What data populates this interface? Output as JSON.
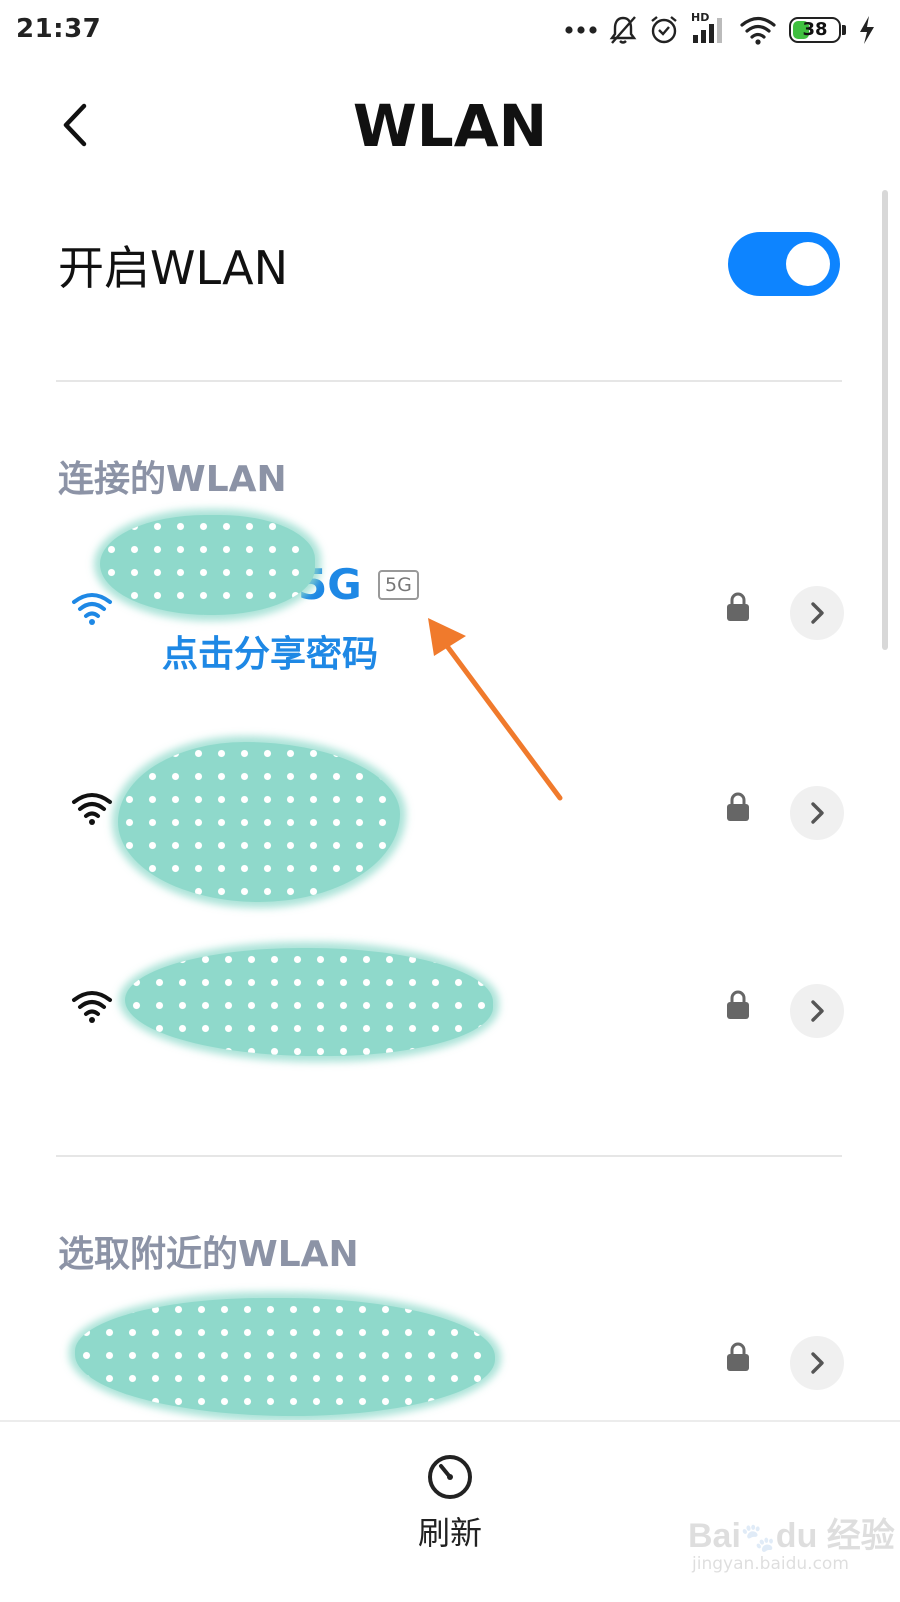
{
  "status_bar": {
    "time": "21:37",
    "network_label": "HD",
    "battery_level": "38",
    "battery_fraction": 0.38,
    "icons": [
      "more-dots-icon",
      "bell-muted-icon",
      "alarm-icon",
      "cellular-signal-icon",
      "wifi-status-icon",
      "battery-icon",
      "charging-bolt-icon"
    ]
  },
  "header": {
    "title": "WLAN",
    "back_icon": "chevron-left-icon"
  },
  "wlan_toggle": {
    "label": "开启WLAN",
    "on": true,
    "color": "#0d84ff"
  },
  "connected_section": {
    "title": "连接的WLAN",
    "networks": [
      {
        "name_visible": "5G",
        "band": "5G",
        "action": "点击分享密码",
        "connected": true,
        "secured": true
      },
      {
        "secured": true
      },
      {
        "secured": true
      }
    ]
  },
  "nearby_section": {
    "title": "选取附近的WLAN",
    "networks": [
      {
        "secured": true
      }
    ]
  },
  "bottom_bar": {
    "refresh_label": "刷新",
    "refresh_icon": "refresh-icon"
  },
  "colors": {
    "accent": "#0d84ff",
    "link": "#1e88e5",
    "section_title": "#8c93a6",
    "annotation_arrow": "#f07a2c",
    "redaction": "#8fd9cb"
  }
}
